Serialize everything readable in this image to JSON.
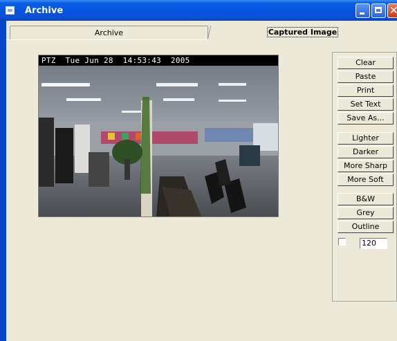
{
  "window": {
    "title": "Archive"
  },
  "tabs": [
    {
      "label": "Archive"
    },
    {
      "label": "Captured Image"
    }
  ],
  "image": {
    "overlay_text": "PTZ  Tue Jun 28  14:53:43  2005",
    "description_icon": "camera-snapshot"
  },
  "panel": {
    "group1": [
      "Clear",
      "Paste",
      "Print",
      "Set Text",
      "Save As..."
    ],
    "group2": [
      "Lighter",
      "Darker",
      "More Sharp",
      "More Soft"
    ],
    "group3": [
      "B&W",
      "Grey",
      "Outline"
    ],
    "threshold_value": "120",
    "checkbox_checked": false
  }
}
